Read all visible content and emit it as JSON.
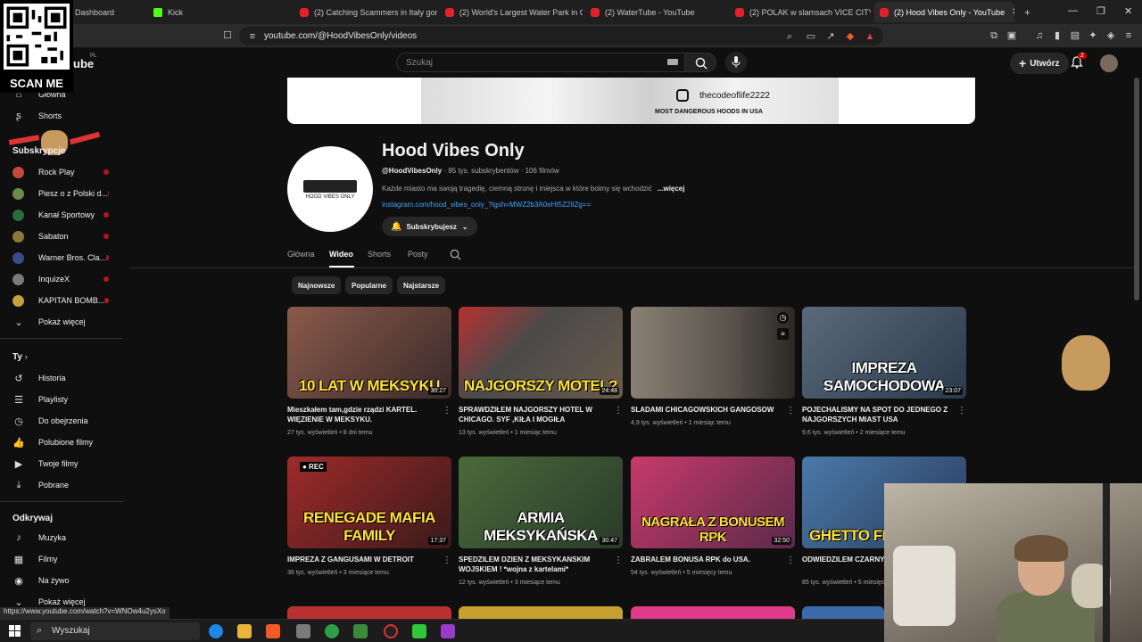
{
  "browser": {
    "tabs": [
      {
        "label": "Dashboard",
        "favicon": "dashboard-icon"
      },
      {
        "label": "Kick",
        "favicon": "kick-icon"
      },
      {
        "label": "(2) Catching Scammers in Italy gone",
        "favicon": "youtube-icon"
      },
      {
        "label": "(2) World's Largest Water Park in Gh",
        "favicon": "youtube-icon"
      },
      {
        "label": "(2) WaterTube - YouTube",
        "favicon": "youtube-icon"
      },
      {
        "label": "(2) POLAK w slamsach VICE CITY - Yo",
        "favicon": "youtube-icon"
      },
      {
        "label": "(2) Hood Vibes Only - YouTube",
        "favicon": "youtube-icon",
        "active": true
      }
    ],
    "url": "youtube.com/@HoodVibesOnly/videos",
    "status_url": "https://www.youtube.com/watch?v=WNOw4u2ysXo"
  },
  "overlay": {
    "qr_label": "SCAN ME"
  },
  "yt_header": {
    "logo_region": "PL",
    "search_placeholder": "Szukaj",
    "create_label": "Utwórz",
    "notifications_count": "2"
  },
  "sidebar": {
    "main": [
      {
        "label": "Główna",
        "icon": "home-icon"
      },
      {
        "label": "Shorts",
        "icon": "shorts-icon"
      }
    ],
    "subscriptions_heading": "Subskrypcje",
    "subscriptions": [
      {
        "label": "Rock Play",
        "color": "#c24a3a"
      },
      {
        "label": "Piesz o z Polski d...",
        "color": "#6a8a4a"
      },
      {
        "label": "Kanał Sportowy",
        "color": "#2a6e3a"
      },
      {
        "label": "Sabaton",
        "color": "#8a7a3a"
      },
      {
        "label": "Warner Bros. Cla...",
        "color": "#3a4a8a"
      },
      {
        "label": "InquizeX",
        "color": "#7a7a7a"
      },
      {
        "label": "KAPITAN BOMB...",
        "color": "#c8a040"
      }
    ],
    "show_more": "Pokaż więcej",
    "you_heading": "Ty",
    "you_items": [
      {
        "label": "Historia",
        "icon": "history-icon"
      },
      {
        "label": "Playlisty",
        "icon": "playlist-icon"
      },
      {
        "label": "Do obejrzenia",
        "icon": "watch-later-icon"
      },
      {
        "label": "Polubione filmy",
        "icon": "like-icon"
      },
      {
        "label": "Twoje filmy",
        "icon": "your-videos-icon"
      },
      {
        "label": "Pobrane",
        "icon": "download-icon"
      }
    ],
    "explore_heading": "Odkrywaj",
    "explore_items": [
      {
        "label": "Muzyka",
        "icon": "music-icon"
      },
      {
        "label": "Filmy",
        "icon": "film-icon"
      },
      {
        "label": "Na żywo",
        "icon": "live-icon"
      }
    ],
    "show_more_2": "Pokaż więcej"
  },
  "banner": {
    "handle": "thecodeoflife2222",
    "tagline": "MOST DANGEROUS HOODS IN USA"
  },
  "channel": {
    "name": "Hood Vibes Only",
    "handle": "@HoodVibesOnly",
    "stats": " · 85 tys. subskrybentów · 106 filmów",
    "description": "Każde miasto ma swoją tragedię, ciemną stronę i miejsca w które boimy się wchodzić",
    "more": "...więcej",
    "link": "instagram.com/hood_vibes_only_?igsh=MWZ2b3A0eHI5Z2lIZg==",
    "avatar_text": "HOOD VIBES ONLY",
    "subscribe_label": "Subskrybujesz"
  },
  "channel_tabs": [
    "Główna",
    "Wideo",
    "Shorts",
    "Posty"
  ],
  "chips": [
    "Najnowsze",
    "Popularne",
    "Najstarsze"
  ],
  "videos": [
    {
      "title": "Mieszkałem tam,gdzie rządzi KARTEL. WIĘZIENIE W MEKSYKU.",
      "views": "27 tys. wyświetleń",
      "age": "8 dni temu",
      "overlay": "10 LAT W MEKSYKU",
      "duration": "30:27",
      "color": "#7a3a2a"
    },
    {
      "title": "SPRAWDZIŁEM NAJGORSZY HOTEL W CHICAGO. SYF ,KIŁA I MOGIŁA",
      "views": "13 tys. wyświetleń",
      "age": "1 miesiąc temu",
      "overlay": "NAJGORSZY MOTEL?",
      "duration": "24:48",
      "color": "#5a4a3a"
    },
    {
      "title": "SLADAMI CHICAGOWSKICH GANGOSOW",
      "views": "4,9 tys. wyświetleń",
      "age": "1 miesiąc temu",
      "overlay": "",
      "duration": "",
      "color": "#6a6258"
    },
    {
      "title": "POJECHALISMY NA SPOT DO JEDNEGO Z NAJGORSZYCH MIAST USA",
      "views": "9,6 tys. wyświetleń",
      "age": "2 miesiące temu",
      "overlay": "IMPREZA SAMOCHODOWA",
      "duration": "23:07",
      "color": "#4a5a6a"
    },
    {
      "title": "IMPREZA Z GANGUSAMI W DETROIT",
      "views": "36 tys. wyświetleń",
      "age": "3 miesiące temu",
      "overlay": "RENEGADE MAFIA FAMILY",
      "duration": "17:37",
      "color": "#8a2a2a"
    },
    {
      "title": "SPEDZILEM DZIEN Z MEKSYKANSKIM WOJSKIEM ! *wojna z kartelami*",
      "views": "12 tys. wyświetleń",
      "age": "3 miesiące temu",
      "overlay": "ARMIA MEKSYKAŃSKA",
      "duration": "30:47",
      "color": "#3a5a3a"
    },
    {
      "title": "ZABRALEM BONUSA RPK do USA.",
      "views": "54 tys. wyświetleń",
      "age": "5 miesięcy temu",
      "overlay": "NAGRAŁA Z BONUSEM RPK",
      "duration": "32:50",
      "color": "#8a3a6a"
    },
    {
      "title": "ODWIEDZILEM CZARNYCH GETTO W USA",
      "views": "85 tys. wyświetleń",
      "age": "5 miesięcy temu",
      "overlay": "GHETTO FLEX",
      "duration": "",
      "color": "#4a6a8a"
    }
  ],
  "taskbar": {
    "search_label": "Wyszukaj"
  }
}
